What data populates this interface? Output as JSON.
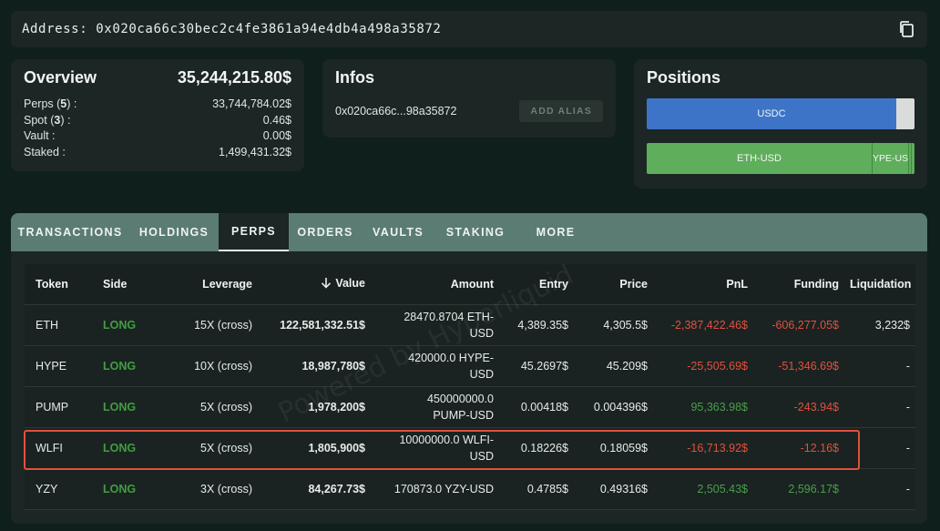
{
  "address_bar": {
    "label": "Address: 0x020ca66c30bec2c4fe3861a94e4db4a498a35872"
  },
  "overview": {
    "title": "Overview",
    "total": "35,244,215.80$",
    "rows": [
      {
        "label": "Perps",
        "count": "5",
        "value": "33,744,784.02$"
      },
      {
        "label": "Spot",
        "count": "3",
        "value": "0.46$"
      },
      {
        "label": "Vault :",
        "value": "0.00$"
      },
      {
        "label": "Staked :",
        "value": "1,499,431.32$"
      }
    ]
  },
  "infos": {
    "title": "Infos",
    "short_address": "0x020ca66c...98a35872",
    "add_alias_label": "ADD ALIAS"
  },
  "positions": {
    "title": "Positions",
    "bar1": {
      "usdc_label": "USDC"
    },
    "bar2": {
      "eth_label": "ETH-USD",
      "hype_label": "YPE-US"
    }
  },
  "tabs": [
    "TRANSACTIONS",
    "HOLDINGS",
    "PERPS",
    "ORDERS",
    "VAULTS",
    "STAKING",
    "MORE"
  ],
  "active_tab": "PERPS",
  "table": {
    "headers": {
      "token": "Token",
      "side": "Side",
      "leverage": "Leverage",
      "value": "Value",
      "amount": "Amount",
      "entry": "Entry",
      "price": "Price",
      "pnl": "PnL",
      "funding": "Funding",
      "liquidation": "Liquidation"
    },
    "rows": [
      {
        "token": "ETH",
        "side": "LONG",
        "leverage": "15X (cross)",
        "value": "122,581,332.51$",
        "amount_1": "28470.8704 ETH-",
        "amount_2": "USD",
        "entry": "4,389.35$",
        "price": "4,305.5$",
        "pnl": "-2,387,422.46$",
        "funding": "-606,277.05$",
        "liquidation": "3,232$"
      },
      {
        "token": "HYPE",
        "side": "LONG",
        "leverage": "10X (cross)",
        "value": "18,987,780$",
        "amount_1": "420000.0 HYPE-",
        "amount_2": "USD",
        "entry": "45.2697$",
        "price": "45.209$",
        "pnl": "-25,505.69$",
        "funding": "-51,346.69$",
        "liquidation": "-"
      },
      {
        "token": "PUMP",
        "side": "LONG",
        "leverage": "5X (cross)",
        "value": "1,978,200$",
        "amount_1": "450000000.0",
        "amount_2": "PUMP-USD",
        "entry": "0.00418$",
        "price": "0.004396$",
        "pnl": "95,363.98$",
        "funding": "-243.94$",
        "liquidation": "-"
      },
      {
        "token": "WLFI",
        "side": "LONG",
        "leverage": "5X (cross)",
        "value": "1,805,900$",
        "amount_1": "10000000.0 WLFI-",
        "amount_2": "USD",
        "entry": "0.18226$",
        "price": "0.18059$",
        "pnl": "-16,713.92$",
        "funding": "-12.16$",
        "liquidation": "-"
      },
      {
        "token": "YZY",
        "side": "LONG",
        "leverage": "3X (cross)",
        "value": "84,267.73$",
        "amount_1": "170873.0 YZY-USD",
        "amount_2": "",
        "entry": "0.4785$",
        "price": "0.49316$",
        "pnl": "2,505.43$",
        "funding": "2,596.17$",
        "liquidation": "-"
      }
    ]
  },
  "watermark": "Powered by Hyperliquid",
  "colors": {
    "positive": "#4b9e4a",
    "negative": "#e0503f",
    "long": "#3f9f3f",
    "tab_bar": "#5b7c72",
    "usdc_bar": "#3d74c8",
    "eth_bar": "#5fae5c"
  }
}
